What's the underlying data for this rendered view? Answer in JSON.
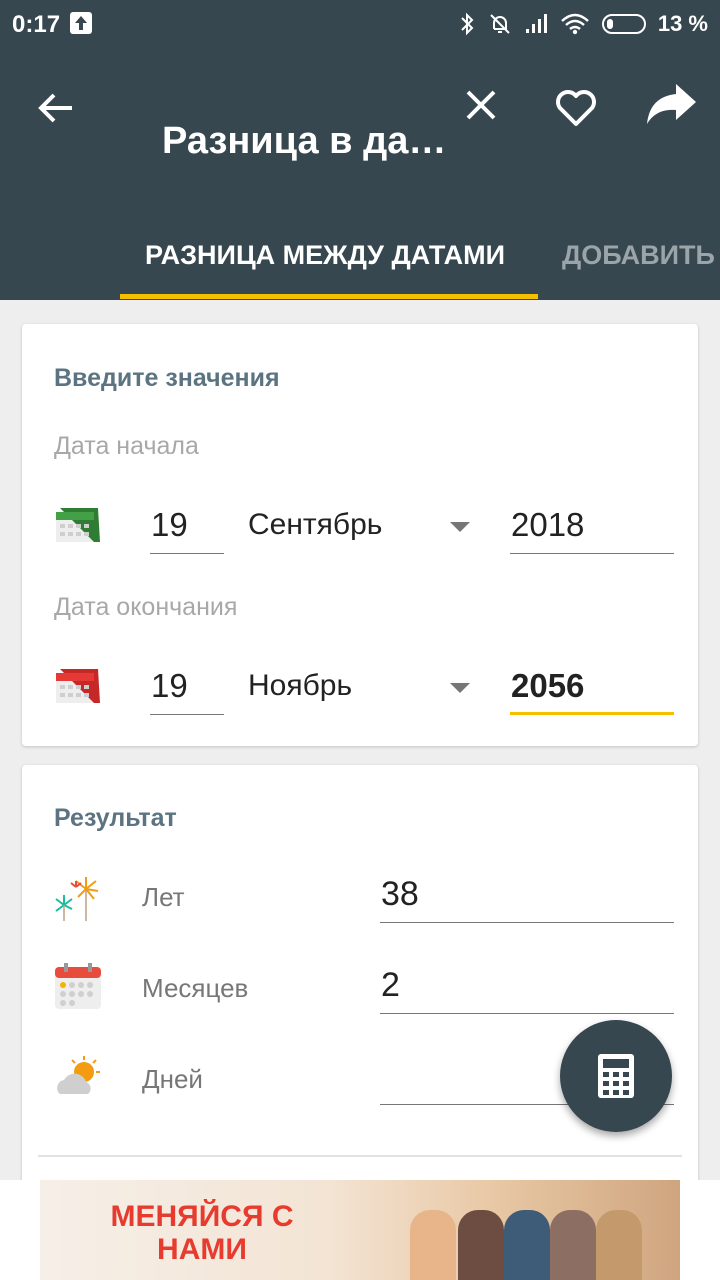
{
  "status_bar": {
    "time": "0:17",
    "battery": "13 %"
  },
  "toolbar": {
    "title": "Разница в да…"
  },
  "tabs": [
    {
      "label": "РАЗНИЦА МЕЖДУ ДАТАМИ",
      "active": true
    },
    {
      "label": "ДОБАВИТЬ ДНИ",
      "active": false
    }
  ],
  "input_card": {
    "title": "Введите значения",
    "start": {
      "label": "Дата начала",
      "day": "19",
      "month": "Сентябрь",
      "year": "2018"
    },
    "end": {
      "label": "Дата окончания",
      "day": "19",
      "month": "Ноябрь",
      "year": "2056"
    }
  },
  "result_card": {
    "title": "Результат",
    "rows": [
      {
        "label": "Лет",
        "value": "38"
      },
      {
        "label": "Месяцев",
        "value": "2"
      },
      {
        "label": "Дней",
        "value": ""
      }
    ]
  },
  "ad": {
    "text": "МЕНЯЙСЯ С НАМИ"
  },
  "colors": {
    "primary": "#37474f",
    "accent": "#f5c000",
    "card_title": "#5c7481"
  },
  "icons": [
    "back-arrow-icon",
    "close-icon",
    "heart-icon",
    "share-icon",
    "calendar-green-icon",
    "calendar-red-icon",
    "fireworks-icon",
    "calendar-grid-icon",
    "sun-cloud-icon",
    "calculator-icon"
  ]
}
